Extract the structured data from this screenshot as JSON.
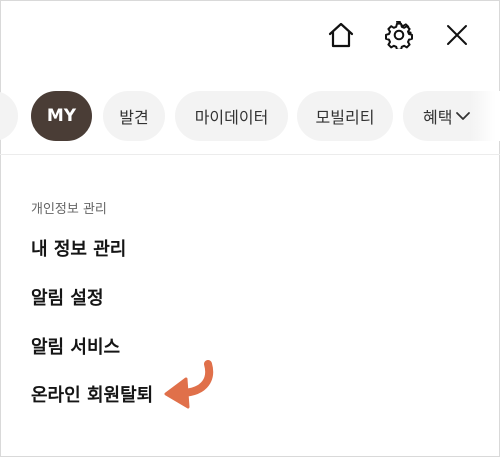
{
  "header": {
    "icons": [
      "home-icon",
      "gear-icon",
      "close-icon"
    ]
  },
  "chips": {
    "partial_label": "",
    "items": [
      {
        "label": "MY",
        "active": true
      },
      {
        "label": "발견",
        "active": false
      },
      {
        "label": "마이데이터",
        "active": false
      },
      {
        "label": "모빌리티",
        "active": false
      },
      {
        "label": "혜택",
        "active": false
      }
    ],
    "more_icon": "chevron-down-icon"
  },
  "section": {
    "label": "개인정보 관리",
    "items": [
      {
        "label": "내 정보 관리"
      },
      {
        "label": "알림 설정"
      },
      {
        "label": "알림 서비스"
      },
      {
        "label": "온라인 회원탈퇴"
      }
    ]
  },
  "annotation": {
    "icon": "curved-arrow-icon",
    "color": "#e0704a"
  },
  "colors": {
    "active_chip_bg": "#4a3d36",
    "chip_bg": "#f3f3f3",
    "text": "#151515"
  }
}
